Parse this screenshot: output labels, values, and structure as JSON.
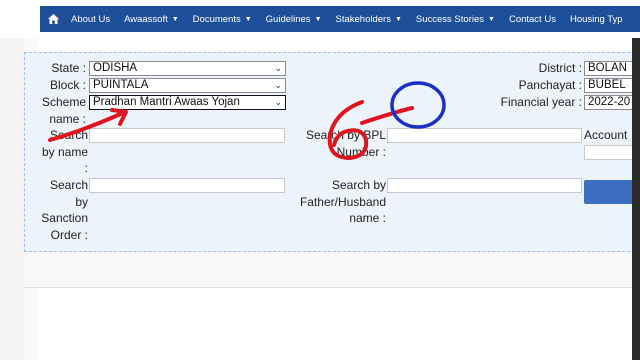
{
  "nav": {
    "home_icon": "home-icon",
    "items": [
      {
        "label": "About Us",
        "dropdown": false
      },
      {
        "label": "Awaassoft",
        "dropdown": true
      },
      {
        "label": "Documents",
        "dropdown": true
      },
      {
        "label": "Guidelines",
        "dropdown": true
      },
      {
        "label": "Stakeholders",
        "dropdown": true
      },
      {
        "label": "Success Stories",
        "dropdown": true
      },
      {
        "label": "Contact Us",
        "dropdown": false
      },
      {
        "label": "Housing Typ",
        "dropdown": false
      }
    ]
  },
  "form": {
    "state_label": "State :",
    "state_value": "ODISHA",
    "block_label": "Block :",
    "block_value": "PUINTALA",
    "scheme_label": "Scheme name :",
    "scheme_value": "Pradhan Mantri Awaas Yojan",
    "district_label": "District :",
    "district_value": "BOLAN",
    "panchayat_label": "Panchayat :",
    "panchayat_value": "BUBEL",
    "fy_label": "Financial year :",
    "fy_value": "2022-20",
    "search_name_label": "Search by name :",
    "search_bpl_label": "Search by BPL Number :",
    "account_label": "Account",
    "search_sanction_label": "Search by Sanction Order :",
    "search_father_label": "Search by Father/Husband name :"
  },
  "colors": {
    "nav_bg": "#1d4f9a",
    "panel_bg": "#edf3fb",
    "annotation_red": "#e0141e",
    "annotation_blue": "#1c2fc4",
    "button": "#3d6fc1"
  }
}
